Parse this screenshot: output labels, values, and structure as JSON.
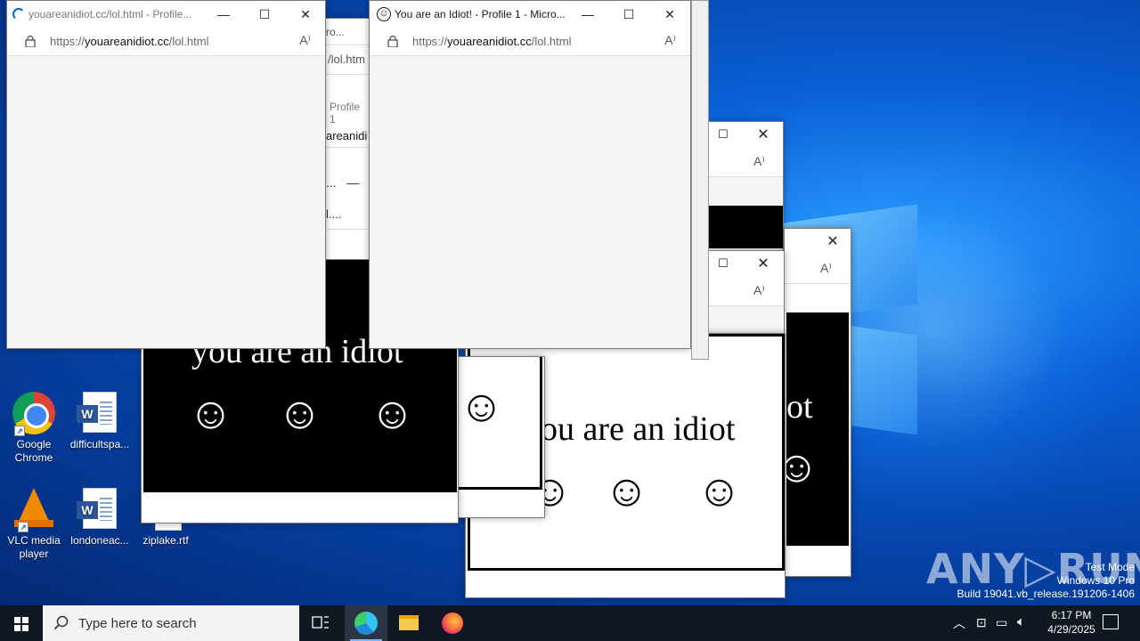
{
  "desktop": {
    "icons": [
      {
        "label_1": "Google",
        "label_2": "Chrome",
        "icon": "chrome-icon"
      },
      {
        "label_1": "difficultspa...",
        "label_2": "",
        "icon": "word-doc-icon"
      },
      {
        "label_1": "VLC media",
        "label_2": "player",
        "icon": "vlc-icon"
      },
      {
        "label_1": "londoneac...",
        "label_2": "",
        "icon": "word-doc-icon"
      },
      {
        "label_1": "ziplake.rtf",
        "label_2": "",
        "icon": "rtf-doc-icon"
      }
    ]
  },
  "windows": {
    "front_left": {
      "title": "youareanidiot.cc/lol.html - Profile...",
      "url_prefix": "https://",
      "url_domain": "youareanidiot.cc",
      "url_path": "/lol.html"
    },
    "front_center": {
      "title": "You are an Idiot! - Profile 1 - Micro...",
      "url_prefix": "https://",
      "url_domain": "youareanidiot.cc",
      "url_path": "/lol.html"
    },
    "behind_partial": {
      "title_fragment": "ro...",
      "url_fragment": "/lol.htm",
      "tab_fragment": "Profile 1",
      "domain_fragment": "areanidi",
      "other_fragment": "l...."
    }
  },
  "idiot_page": {
    "text": "you are an idiot",
    "smiley": "☺",
    "partial_text": "ot"
  },
  "taskbar": {
    "search_placeholder": "Type here to search",
    "time": "6:17 PM",
    "date": "4/29/2025"
  },
  "watermark": {
    "brand": "ANY▷RUN",
    "line1": "Test Mode",
    "line2": "Windows 10 Pro",
    "line3": "Build 19041.vb_release.191206-1406"
  },
  "colors": {
    "taskbar_bg": "#101822",
    "desktop_blue": "#0a5fd6"
  }
}
